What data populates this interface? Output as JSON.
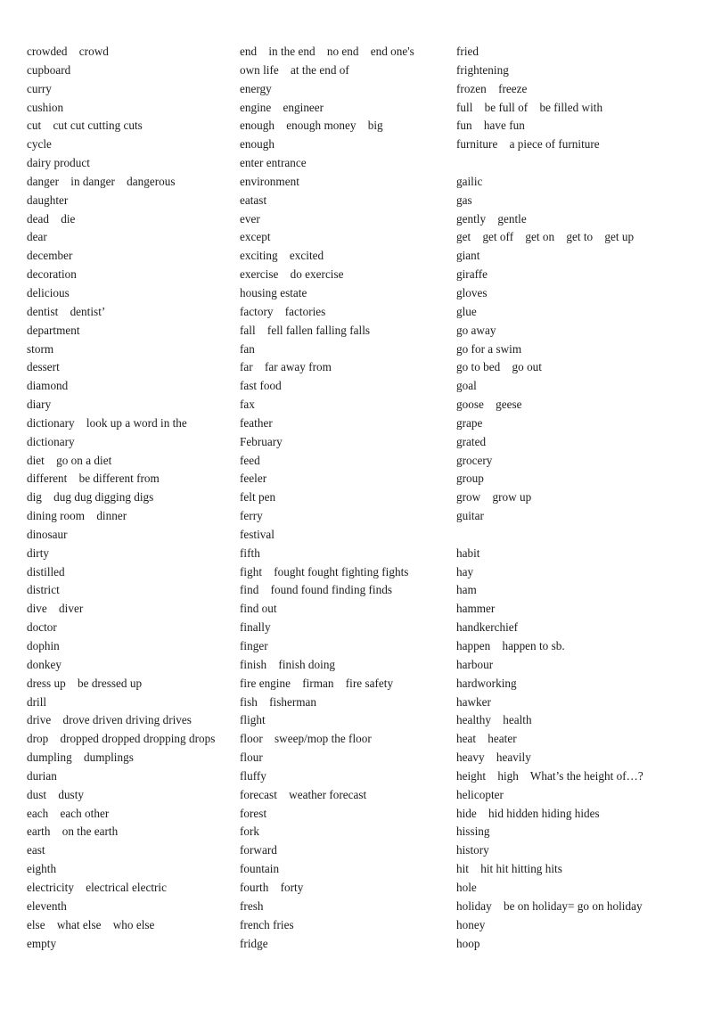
{
  "document": {
    "title": "Vocabulary Word List",
    "background_color": "#ffffff",
    "text_color": "#1c1c1c"
  },
  "columns": [
    {
      "name": "column-left",
      "entries": [
        "crowded    crowd",
        "cupboard",
        "curry",
        "cushion",
        "cut    cut cut cutting cuts",
        "cycle",
        "dairy product",
        "danger    in danger    dangerous",
        "daughter",
        "dead    die",
        "dear",
        "december",
        "decoration",
        "delicious",
        "dentist    dentist’",
        "department",
        "storm",
        "dessert",
        "diamond",
        "diary",
        "dictionary    look up a word in the",
        "dictionary",
        "diet    go on a diet",
        "different    be different from",
        "dig    dug dug digging digs",
        "dining room    dinner",
        "dinosaur",
        "dirty",
        "distilled",
        "district",
        "dive    diver",
        "doctor",
        "dophin",
        "donkey",
        "dress up    be dressed up",
        "drill",
        "drive    drove driven driving drives",
        "drop    dropped dropped dropping drops",
        "dumpling    dumplings",
        "durian",
        "dust    dusty",
        "each    each other",
        "earth    on the earth",
        "east",
        "eighth",
        "electricity    electrical electric",
        "eleventh",
        "else    what else    who else",
        "empty"
      ]
    },
    {
      "name": "column-middle",
      "entries": [
        "end    in the end    no end    end one's",
        "own life    at the end of",
        "energy",
        "engine    engineer",
        "enough    enough money    big",
        "enough",
        "enter entrance",
        "environment",
        "eatast",
        "ever",
        "except",
        "exciting    excited",
        "exercise    do exercise",
        "housing estate",
        "factory    factories",
        "fall    fell fallen falling falls",
        "fan",
        "far    far away from",
        "fast food",
        "fax",
        "feather",
        "February",
        "feed",
        "feeler",
        "felt pen",
        "ferry",
        "festival",
        "fifth",
        "fight    fought fought fighting fights",
        "find    found found finding finds",
        "find out",
        "finally",
        "finger",
        "finish    finish doing",
        "fire engine    firman    fire safety",
        "fish    fisherman",
        "flight",
        "floor    sweep/mop the floor",
        "flour",
        "fluffy",
        "forecast    weather forecast",
        "forest",
        "fork",
        "forward",
        "fountain",
        "fourth    forty",
        "fresh",
        "french fries",
        "fridge"
      ]
    },
    {
      "name": "column-right",
      "entries": [
        "fried",
        "frightening",
        "frozen    freeze",
        "full    be full of    be filled with",
        "fun    have fun",
        "furniture    a piece of furniture",
        "",
        "gailic",
        "gas",
        "gently    gentle",
        "get    get off    get on    get to    get up",
        "giant",
        "giraffe",
        "gloves",
        "glue",
        "go away",
        "go for a swim",
        "go to bed    go out",
        "goal",
        "goose    geese",
        "grape",
        "grated",
        "grocery",
        "group",
        "grow    grow up",
        "guitar",
        "",
        "habit",
        "hay",
        "ham",
        "hammer",
        "handkerchief",
        "happen    happen to sb.",
        "harbour",
        "hardworking",
        "hawker",
        "healthy    health",
        "heat    heater",
        "heavy    heavily",
        "height    high    What’s the height of…?",
        "helicopter",
        "hide    hid hidden hiding hides",
        "hissing",
        "history",
        "hit    hit hit hitting hits",
        "hole",
        "holiday    be on holiday= go on holiday",
        "honey",
        "hoop"
      ]
    }
  ]
}
